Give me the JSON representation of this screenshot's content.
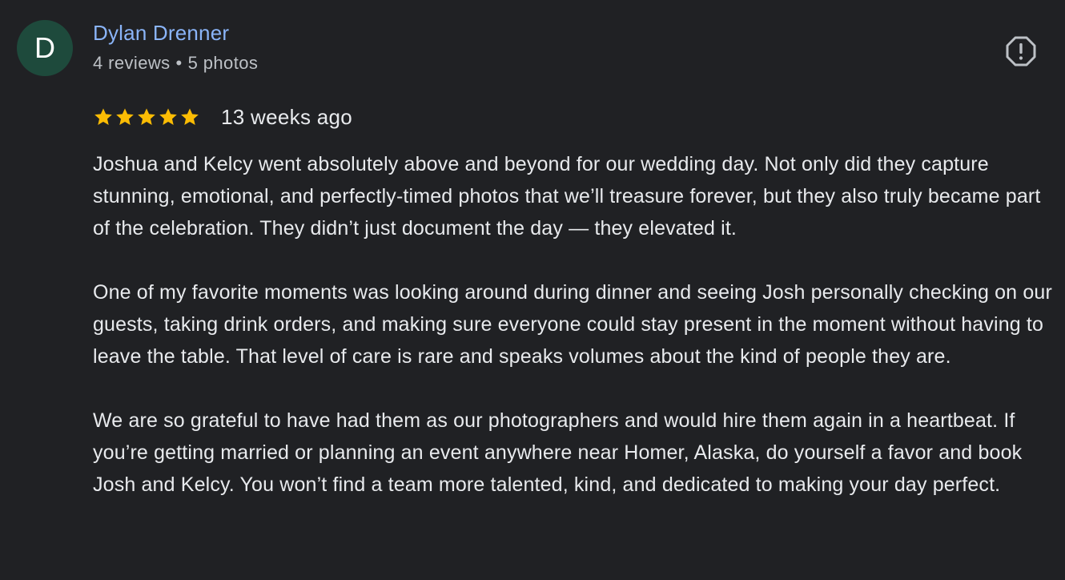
{
  "author": {
    "initial": "D",
    "avatar_color": "#1e4a3c",
    "name": "Dylan Drenner",
    "reviews": "4 reviews",
    "separator": "•",
    "photos": "5 photos"
  },
  "review": {
    "rating": 5,
    "max_rating": 5,
    "star_color": "#fbbc04",
    "date": "13 weeks ago",
    "paragraphs": [
      "Joshua and Kelcy went absolutely above and beyond for our wedding day. Not only did they capture stunning, emotional, and perfectly-timed photos that we’ll treasure forever, but they also truly became part of the celebration. They didn’t just document the day — they elevated it.",
      "One of my favorite moments was looking around during dinner and seeing Josh personally checking on our guests, taking drink orders, and making sure everyone could stay present in the moment without having to leave the table. That level of care is rare and speaks volumes about the kind of people they are.",
      "We are so grateful to have had them as our photographers and would hire them again in a heartbeat. If you’re getting married or planning an event anywhere near Homer, Alaska, do yourself a favor and book Josh and Kelcy. You won’t find a team more talented, kind, and dedicated to making your day perfect."
    ]
  },
  "icons": {
    "flag": "report-flag-icon",
    "star": "star-icon"
  }
}
